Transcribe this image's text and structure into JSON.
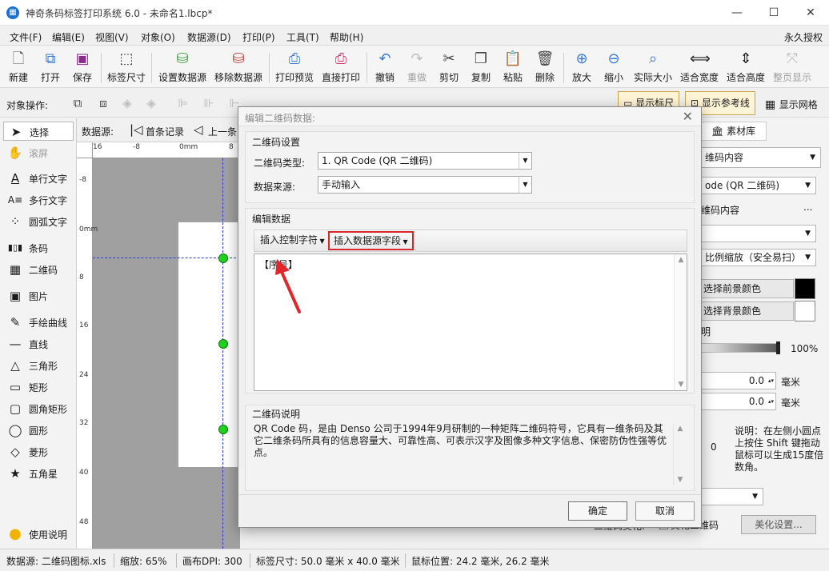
{
  "window": {
    "title": "神奇条码标签打印系统 6.0 - 未命名1.lbcp*",
    "app_icon": "barcode-app-icon",
    "minimize": "—",
    "maximize": "☐",
    "close": "✕"
  },
  "menu": {
    "items": [
      "文件(F)",
      "编辑(E)",
      "视图(V)",
      "对象(O)",
      "数据源(D)",
      "打印(P)",
      "工具(T)",
      "帮助(H)"
    ],
    "license": "永久授权"
  },
  "toolbar": {
    "buttons": [
      {
        "label": "新建",
        "icon": "new-file-icon"
      },
      {
        "label": "打开",
        "icon": "open-file-icon"
      },
      {
        "label": "保存",
        "icon": "save-icon"
      },
      {
        "label": "标签尺寸",
        "icon": "label-size-icon"
      },
      {
        "label": "设置数据源",
        "icon": "set-datasource-icon"
      },
      {
        "label": "移除数据源",
        "icon": "remove-datasource-icon"
      },
      {
        "label": "打印预览",
        "icon": "print-preview-icon"
      },
      {
        "label": "直接打印",
        "icon": "print-icon"
      },
      {
        "label": "撤销",
        "icon": "undo-icon"
      },
      {
        "label": "重做",
        "icon": "redo-icon"
      },
      {
        "label": "剪切",
        "icon": "cut-icon"
      },
      {
        "label": "复制",
        "icon": "copy-icon"
      },
      {
        "label": "粘贴",
        "icon": "paste-icon"
      },
      {
        "label": "删除",
        "icon": "delete-icon"
      },
      {
        "label": "放大",
        "icon": "zoom-in-icon"
      },
      {
        "label": "缩小",
        "icon": "zoom-out-icon"
      },
      {
        "label": "实际大小",
        "icon": "actual-size-icon"
      },
      {
        "label": "适合宽度",
        "icon": "fit-width-icon"
      },
      {
        "label": "适合高度",
        "icon": "fit-height-icon"
      },
      {
        "label": "整页显示",
        "icon": "full-page-icon"
      }
    ]
  },
  "objrow": {
    "label": "对象操作:",
    "show_ruler": "显示标尺",
    "show_guides": "显示参考线",
    "show_grid": "显示网格"
  },
  "tools": {
    "items": [
      {
        "label": "选择",
        "icon": "pointer-icon",
        "glyph": "➤"
      },
      {
        "label": "滚屏",
        "icon": "hand-icon",
        "glyph": "✋"
      },
      {
        "label": "单行文字",
        "icon": "single-text-icon",
        "glyph": "A"
      },
      {
        "label": "多行文字",
        "icon": "multi-text-icon",
        "glyph": "A≡"
      },
      {
        "label": "圆弧文字",
        "icon": "arc-text-icon",
        "glyph": "⁘"
      },
      {
        "label": "条码",
        "icon": "barcode-icon",
        "glyph": "▮▯▮"
      },
      {
        "label": "二维码",
        "icon": "qrcode-icon",
        "glyph": "▦"
      },
      {
        "label": "图片",
        "icon": "picture-icon",
        "glyph": "▣"
      },
      {
        "label": "手绘曲线",
        "icon": "freehand-icon",
        "glyph": "✎"
      },
      {
        "label": "直线",
        "icon": "line-icon",
        "glyph": "—"
      },
      {
        "label": "三角形",
        "icon": "triangle-icon",
        "glyph": "△"
      },
      {
        "label": "矩形",
        "icon": "rectangle-icon",
        "glyph": "▭"
      },
      {
        "label": "圆角矩形",
        "icon": "rounded-rect-icon",
        "glyph": "▢"
      },
      {
        "label": "圆形",
        "icon": "circle-icon",
        "glyph": "◯"
      },
      {
        "label": "菱形",
        "icon": "diamond-icon",
        "glyph": "◇"
      },
      {
        "label": "五角星",
        "icon": "star-icon",
        "glyph": "★"
      }
    ],
    "help": "使用说明"
  },
  "datasource_nav": {
    "label": "数据源:",
    "first": "首条记录",
    "prev": "上一条"
  },
  "rulers": {
    "h": [
      "16",
      "-8",
      "0mm",
      "8"
    ],
    "v": [
      "-8",
      "0mm",
      "8",
      "16",
      "24",
      "32",
      "40",
      "48"
    ]
  },
  "right_panel": {
    "tab": "素材库",
    "content_type": "维码内容",
    "qr_type": "ode (QR 二维码)",
    "content_label": "维码内容",
    "more": "...",
    "scale": "比例缩放（安全易扫）",
    "fg_color_btn": "选择前景颜色",
    "bg_color_btn": "选择背景颜色",
    "fg_color": "#000000",
    "bg_color": "#ffffff",
    "transparency_label": "明",
    "transparency_value": "100%",
    "x_value": "0.0",
    "y_value": "0.0",
    "unit": "毫米",
    "angle_zero": "0",
    "tip": "说明：在左侧小圆点上按住 Shift 键拖动鼠标可以生成15度倍数角。",
    "beautify_label": "二维码美化:",
    "beautify_check": "美化二维码",
    "beautify_btn": "美化设置..."
  },
  "status": {
    "datasource": "数据源: 二维码图标.xls",
    "zoom": "缩放: 65%",
    "dpi": "画布DPI: 300",
    "label_size": "标签尺寸: 50.0 毫米 x 40.0 毫米",
    "mouse": "鼠标位置: 24.2 毫米, 26.2 毫米"
  },
  "dialog": {
    "title": "编辑二维码数据:",
    "settings_group": "二维码设置",
    "type_label": "二维码类型:",
    "type_value": "1. QR Code (QR 二维码)",
    "source_label": "数据来源:",
    "source_value": "手动输入",
    "edit_group": "编辑数据",
    "insert_ctrl": "插入控制字符",
    "insert_field": "插入数据源字段",
    "content": "【序号】",
    "desc_group": "二维码说明",
    "desc": "QR Code 码，是由 Denso 公司于1994年9月研制的一种矩阵二维码符号，它具有一维条码及其它二维条码所具有的信息容量大、可靠性高、可表示汉字及图像多种文字信息、保密防伪性强等优点。",
    "ok": "确定",
    "cancel": "取消",
    "highlight_color": "#d9262c",
    "arrow_color": "#e3262b"
  }
}
